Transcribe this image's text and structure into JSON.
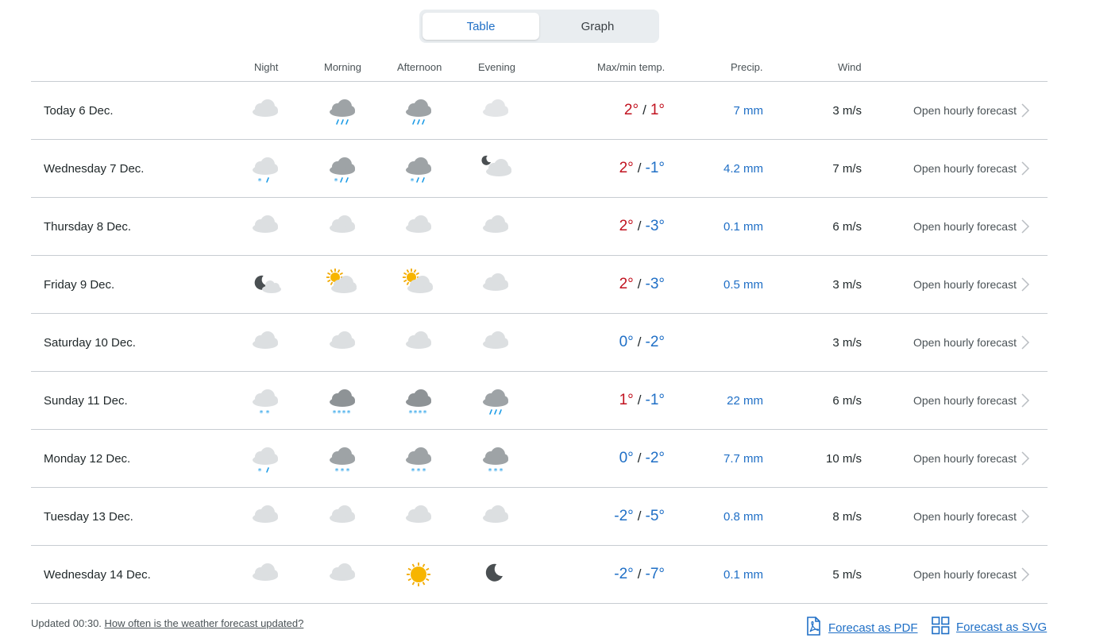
{
  "toggle": {
    "table_label": "Table",
    "graph_label": "Graph",
    "active": "table"
  },
  "headers": {
    "night": "Night",
    "morning": "Morning",
    "afternoon": "Afternoon",
    "evening": "Evening",
    "temp": "Max/min temp.",
    "precip": "Precip.",
    "wind": "Wind"
  },
  "colors": {
    "accent": "#1f6fc6",
    "warm": "#c1121f",
    "divider": "#c8cdd1",
    "toggle_bg": "#e9edf0"
  },
  "rows": [
    {
      "day": "Today 6 Dec.",
      "icons": [
        "cloud",
        "rain-heavy",
        "rain-heavy",
        "cloud-light"
      ],
      "max": "2°",
      "min": "1°",
      "max_warm": true,
      "min_warm": true,
      "precip": "7 mm",
      "wind": "3 m/s",
      "link": "Open hourly forecast"
    },
    {
      "day": "Wednesday 7 Dec.",
      "icons": [
        "sleet-light",
        "sleet-heavy",
        "sleet-heavy",
        "moon-cloud"
      ],
      "max": "2°",
      "min": "-1°",
      "max_warm": true,
      "min_warm": false,
      "precip": "4.2 mm",
      "wind": "7 m/s",
      "link": "Open hourly forecast"
    },
    {
      "day": "Thursday 8 Dec.",
      "icons": [
        "cloud",
        "cloud",
        "cloud",
        "cloud"
      ],
      "max": "2°",
      "min": "-3°",
      "max_warm": true,
      "min_warm": false,
      "precip": "0.1 mm",
      "wind": "6 m/s",
      "link": "Open hourly forecast"
    },
    {
      "day": "Friday 9 Dec.",
      "icons": [
        "moon-dark-cloud",
        "sun-cloud",
        "sun-cloud",
        "cloud"
      ],
      "max": "2°",
      "min": "-3°",
      "max_warm": true,
      "min_warm": false,
      "precip": "0.5 mm",
      "wind": "3 m/s",
      "link": "Open hourly forecast"
    },
    {
      "day": "Saturday 10 Dec.",
      "icons": [
        "cloud",
        "cloud",
        "cloud",
        "cloud"
      ],
      "max": "0°",
      "min": "-2°",
      "max_warm": false,
      "min_warm": false,
      "precip": "",
      "wind": "3 m/s",
      "link": "Open hourly forecast"
    },
    {
      "day": "Sunday 11 Dec.",
      "icons": [
        "snow-light",
        "snow-heavy",
        "snow-heavy",
        "rain-heavy"
      ],
      "max": "1°",
      "min": "-1°",
      "max_warm": true,
      "min_warm": false,
      "precip": "22 mm",
      "wind": "6 m/s",
      "link": "Open hourly forecast"
    },
    {
      "day": "Monday 12 Dec.",
      "icons": [
        "sleet-light",
        "snow-medium",
        "snow-medium",
        "snow-medium"
      ],
      "max": "0°",
      "min": "-2°",
      "max_warm": false,
      "min_warm": false,
      "precip": "7.7 mm",
      "wind": "10 m/s",
      "link": "Open hourly forecast"
    },
    {
      "day": "Tuesday 13 Dec.",
      "icons": [
        "cloud",
        "cloud",
        "cloud",
        "cloud"
      ],
      "max": "-2°",
      "min": "-5°",
      "max_warm": false,
      "min_warm": false,
      "precip": "0.8 mm",
      "wind": "8 m/s",
      "link": "Open hourly forecast"
    },
    {
      "day": "Wednesday 14 Dec.",
      "icons": [
        "cloud",
        "cloud",
        "sun",
        "moon"
      ],
      "max": "-2°",
      "min": "-7°",
      "max_warm": false,
      "min_warm": false,
      "precip": "0.1 mm",
      "wind": "5 m/s",
      "link": "Open hourly forecast"
    }
  ],
  "temp_separator": "/",
  "footer": {
    "updated": "Updated 00:30.",
    "help_link": "How often is the weather forecast updated?",
    "pdf_link": "Forecast as PDF",
    "svg_link": "Forecast as SVG",
    "pdf_icon": "pdf-file-icon",
    "svg_icon": "grid-icon"
  }
}
